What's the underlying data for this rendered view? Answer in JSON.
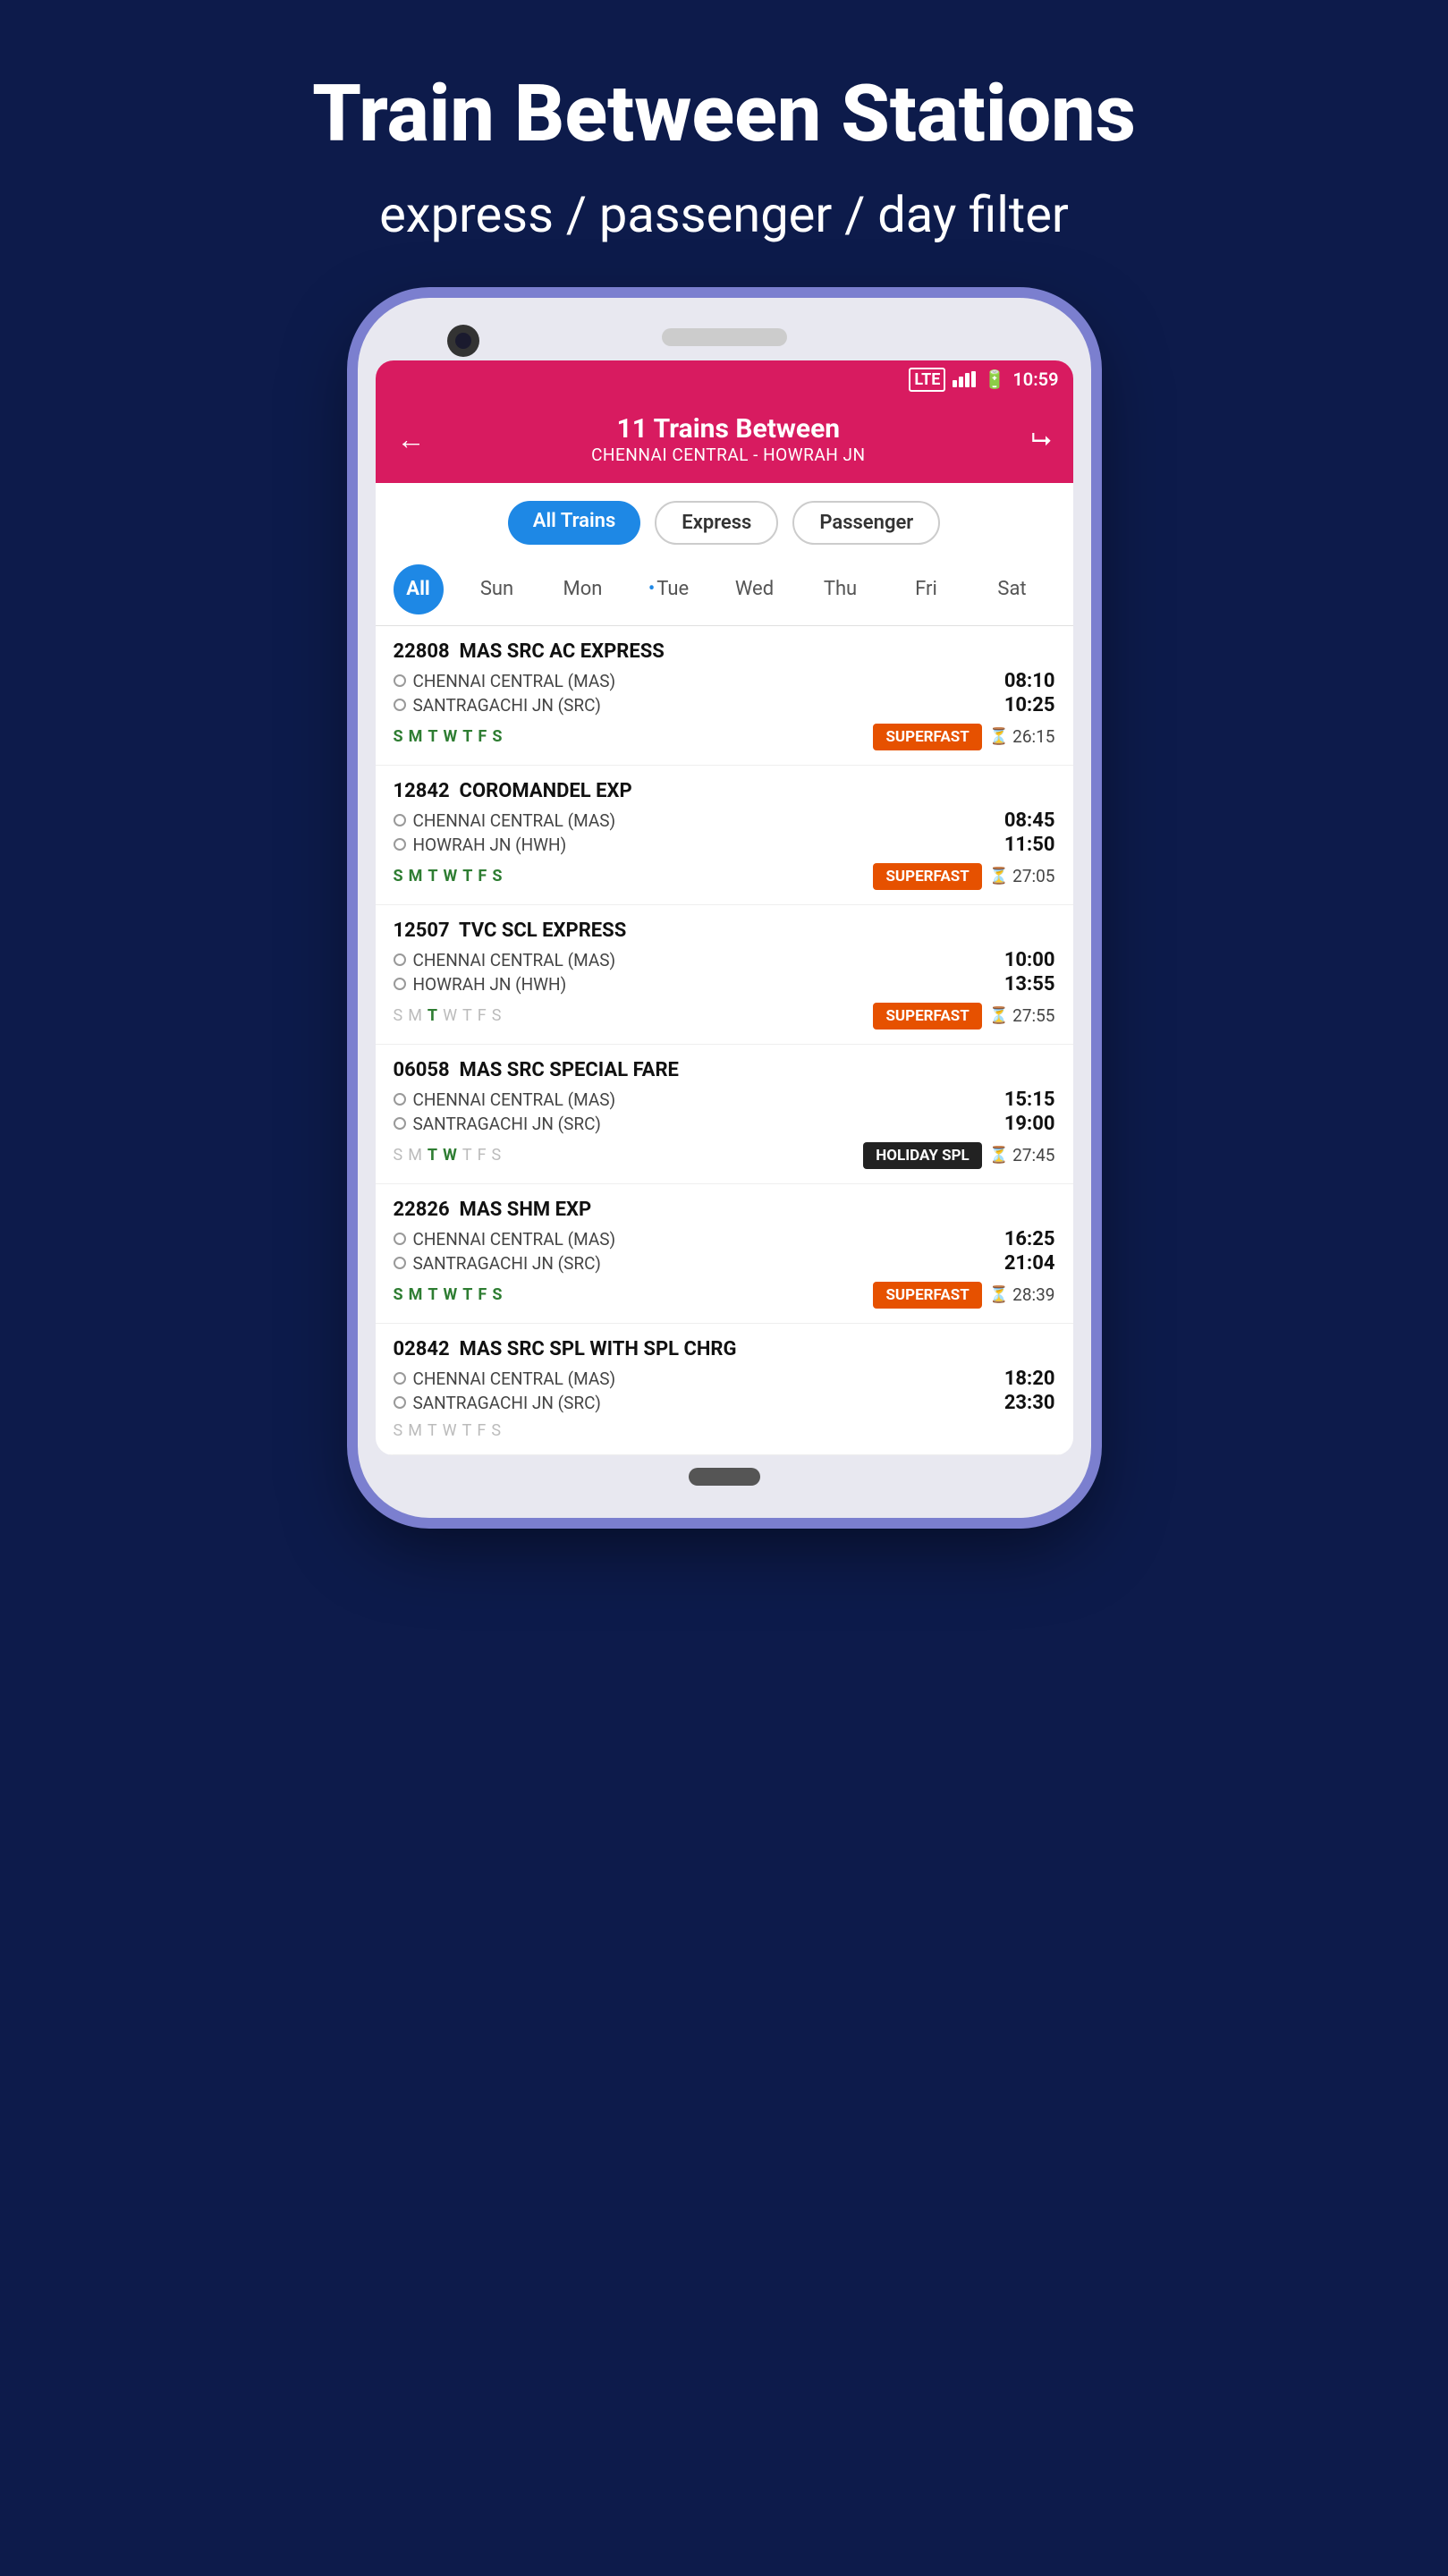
{
  "page": {
    "title": "Train Between Stations",
    "subtitle": "express / passenger / day filter"
  },
  "statusBar": {
    "lte": "LTE",
    "time": "10:59"
  },
  "header": {
    "count": "11 Trains Between",
    "route": "CHENNAI CENTRAL - HOWRAH JN"
  },
  "filterTabs": [
    {
      "label": "All Trains",
      "active": true
    },
    {
      "label": "Express",
      "active": false
    },
    {
      "label": "Passenger",
      "active": false
    }
  ],
  "dayFilter": {
    "allLabel": "All",
    "days": [
      "Sun",
      "Mon",
      "•Tue",
      "Wed",
      "Thu",
      "Fri",
      "Sat"
    ]
  },
  "trains": [
    {
      "number": "22808",
      "name": "MAS SRC AC EXPRESS",
      "from": "CHENNAI CENTRAL (MAS)",
      "fromTime": "08:10",
      "to": "SANTRAGACHI JN (SRC)",
      "toTime": "10:25",
      "days": [
        "S",
        "M",
        "T",
        "W",
        "T",
        "F",
        "S"
      ],
      "daysGreen": [
        0,
        1,
        2,
        3,
        4,
        5,
        6
      ],
      "badge": "SUPERFAST",
      "badgeType": "orange",
      "duration": "26:15"
    },
    {
      "number": "12842",
      "name": "COROMANDEL EXP",
      "from": "CHENNAI CENTRAL (MAS)",
      "fromTime": "08:45",
      "to": "HOWRAH JN (HWH)",
      "toTime": "11:50",
      "days": [
        "S",
        "M",
        "T",
        "W",
        "T",
        "F",
        "S"
      ],
      "daysGreen": [
        0,
        1,
        2,
        3,
        4,
        5,
        6
      ],
      "badge": "SUPERFAST",
      "badgeType": "orange",
      "duration": "27:05"
    },
    {
      "number": "12507",
      "name": "TVC SCL EXPRESS",
      "from": "CHENNAI CENTRAL (MAS)",
      "fromTime": "10:00",
      "to": "HOWRAH JN (HWH)",
      "toTime": "13:55",
      "days": [
        "S",
        "M",
        "T",
        "W",
        "T",
        "F",
        "S"
      ],
      "daysGreen": [
        2
      ],
      "badge": "SUPERFAST",
      "badgeType": "orange",
      "duration": "27:55"
    },
    {
      "number": "06058",
      "name": "MAS SRC SPECIAL FARE",
      "from": "CHENNAI CENTRAL (MAS)",
      "fromTime": "15:15",
      "to": "SANTRAGACHI JN (SRC)",
      "toTime": "19:00",
      "days": [
        "S",
        "M",
        "T",
        "W",
        "T",
        "F",
        "S"
      ],
      "daysGreen": [
        2,
        3
      ],
      "badge": "HOLIDAY SPL",
      "badgeType": "black",
      "duration": "27:45"
    },
    {
      "number": "22826",
      "name": "MAS SHM EXP",
      "from": "CHENNAI CENTRAL (MAS)",
      "fromTime": "16:25",
      "to": "SANTRAGACHI JN (SRC)",
      "toTime": "21:04",
      "days": [
        "S",
        "M",
        "T",
        "W",
        "T",
        "F",
        "S"
      ],
      "daysGreen": [
        0,
        1,
        2,
        3,
        4,
        5,
        6
      ],
      "badge": "SUPERFAST",
      "badgeType": "orange",
      "duration": "28:39"
    },
    {
      "number": "02842",
      "name": "MAS SRC SPL WITH SPL CHRG",
      "from": "CHENNAI CENTRAL (MAS)",
      "fromTime": "18:20",
      "to": "SANTRAGACHI JN (SRC)",
      "toTime": "23:30",
      "days": [
        "S",
        "M",
        "T",
        "W",
        "T",
        "F",
        "S"
      ],
      "daysGreen": [],
      "badge": "",
      "badgeType": "",
      "duration": ""
    }
  ],
  "daysMap": {
    "0": "S",
    "1": "M",
    "2": "T",
    "3": "W",
    "4": "T",
    "5": "F",
    "6": "S"
  }
}
